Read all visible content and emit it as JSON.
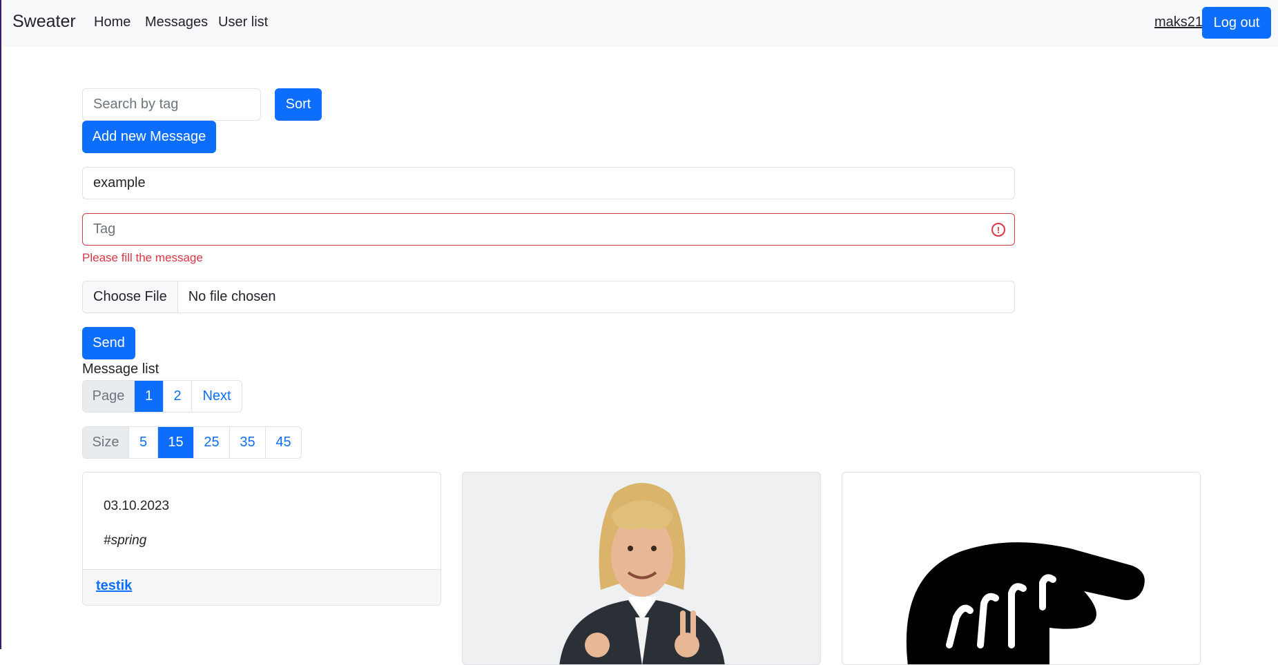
{
  "navbar": {
    "brand": "Sweater",
    "links": [
      "Home",
      "Messages",
      "User list"
    ],
    "username": "maks21",
    "logout_label": "Log out"
  },
  "search": {
    "placeholder": "Search by tag",
    "sort_label": "Sort"
  },
  "add_message_label": "Add new Message",
  "form": {
    "text_value": "example",
    "tag_placeholder": "Tag",
    "tag_error": "Please fill the message",
    "file_button": "Choose File",
    "file_status": "No file chosen",
    "send_label": "Send"
  },
  "message_list_label": "Message list",
  "pagination": {
    "label": "Page",
    "pages": [
      "1",
      "2",
      "Next"
    ],
    "active": "1"
  },
  "page_size": {
    "label": "Size",
    "options": [
      "5",
      "15",
      "25",
      "35",
      "45"
    ],
    "active": "15"
  },
  "messages": [
    {
      "date": "03.10.2023",
      "tag": "#spring",
      "author": "testik"
    },
    {
      "image": "smiling-man-photo"
    },
    {
      "image": "black-hand-pointing-icon"
    }
  ]
}
